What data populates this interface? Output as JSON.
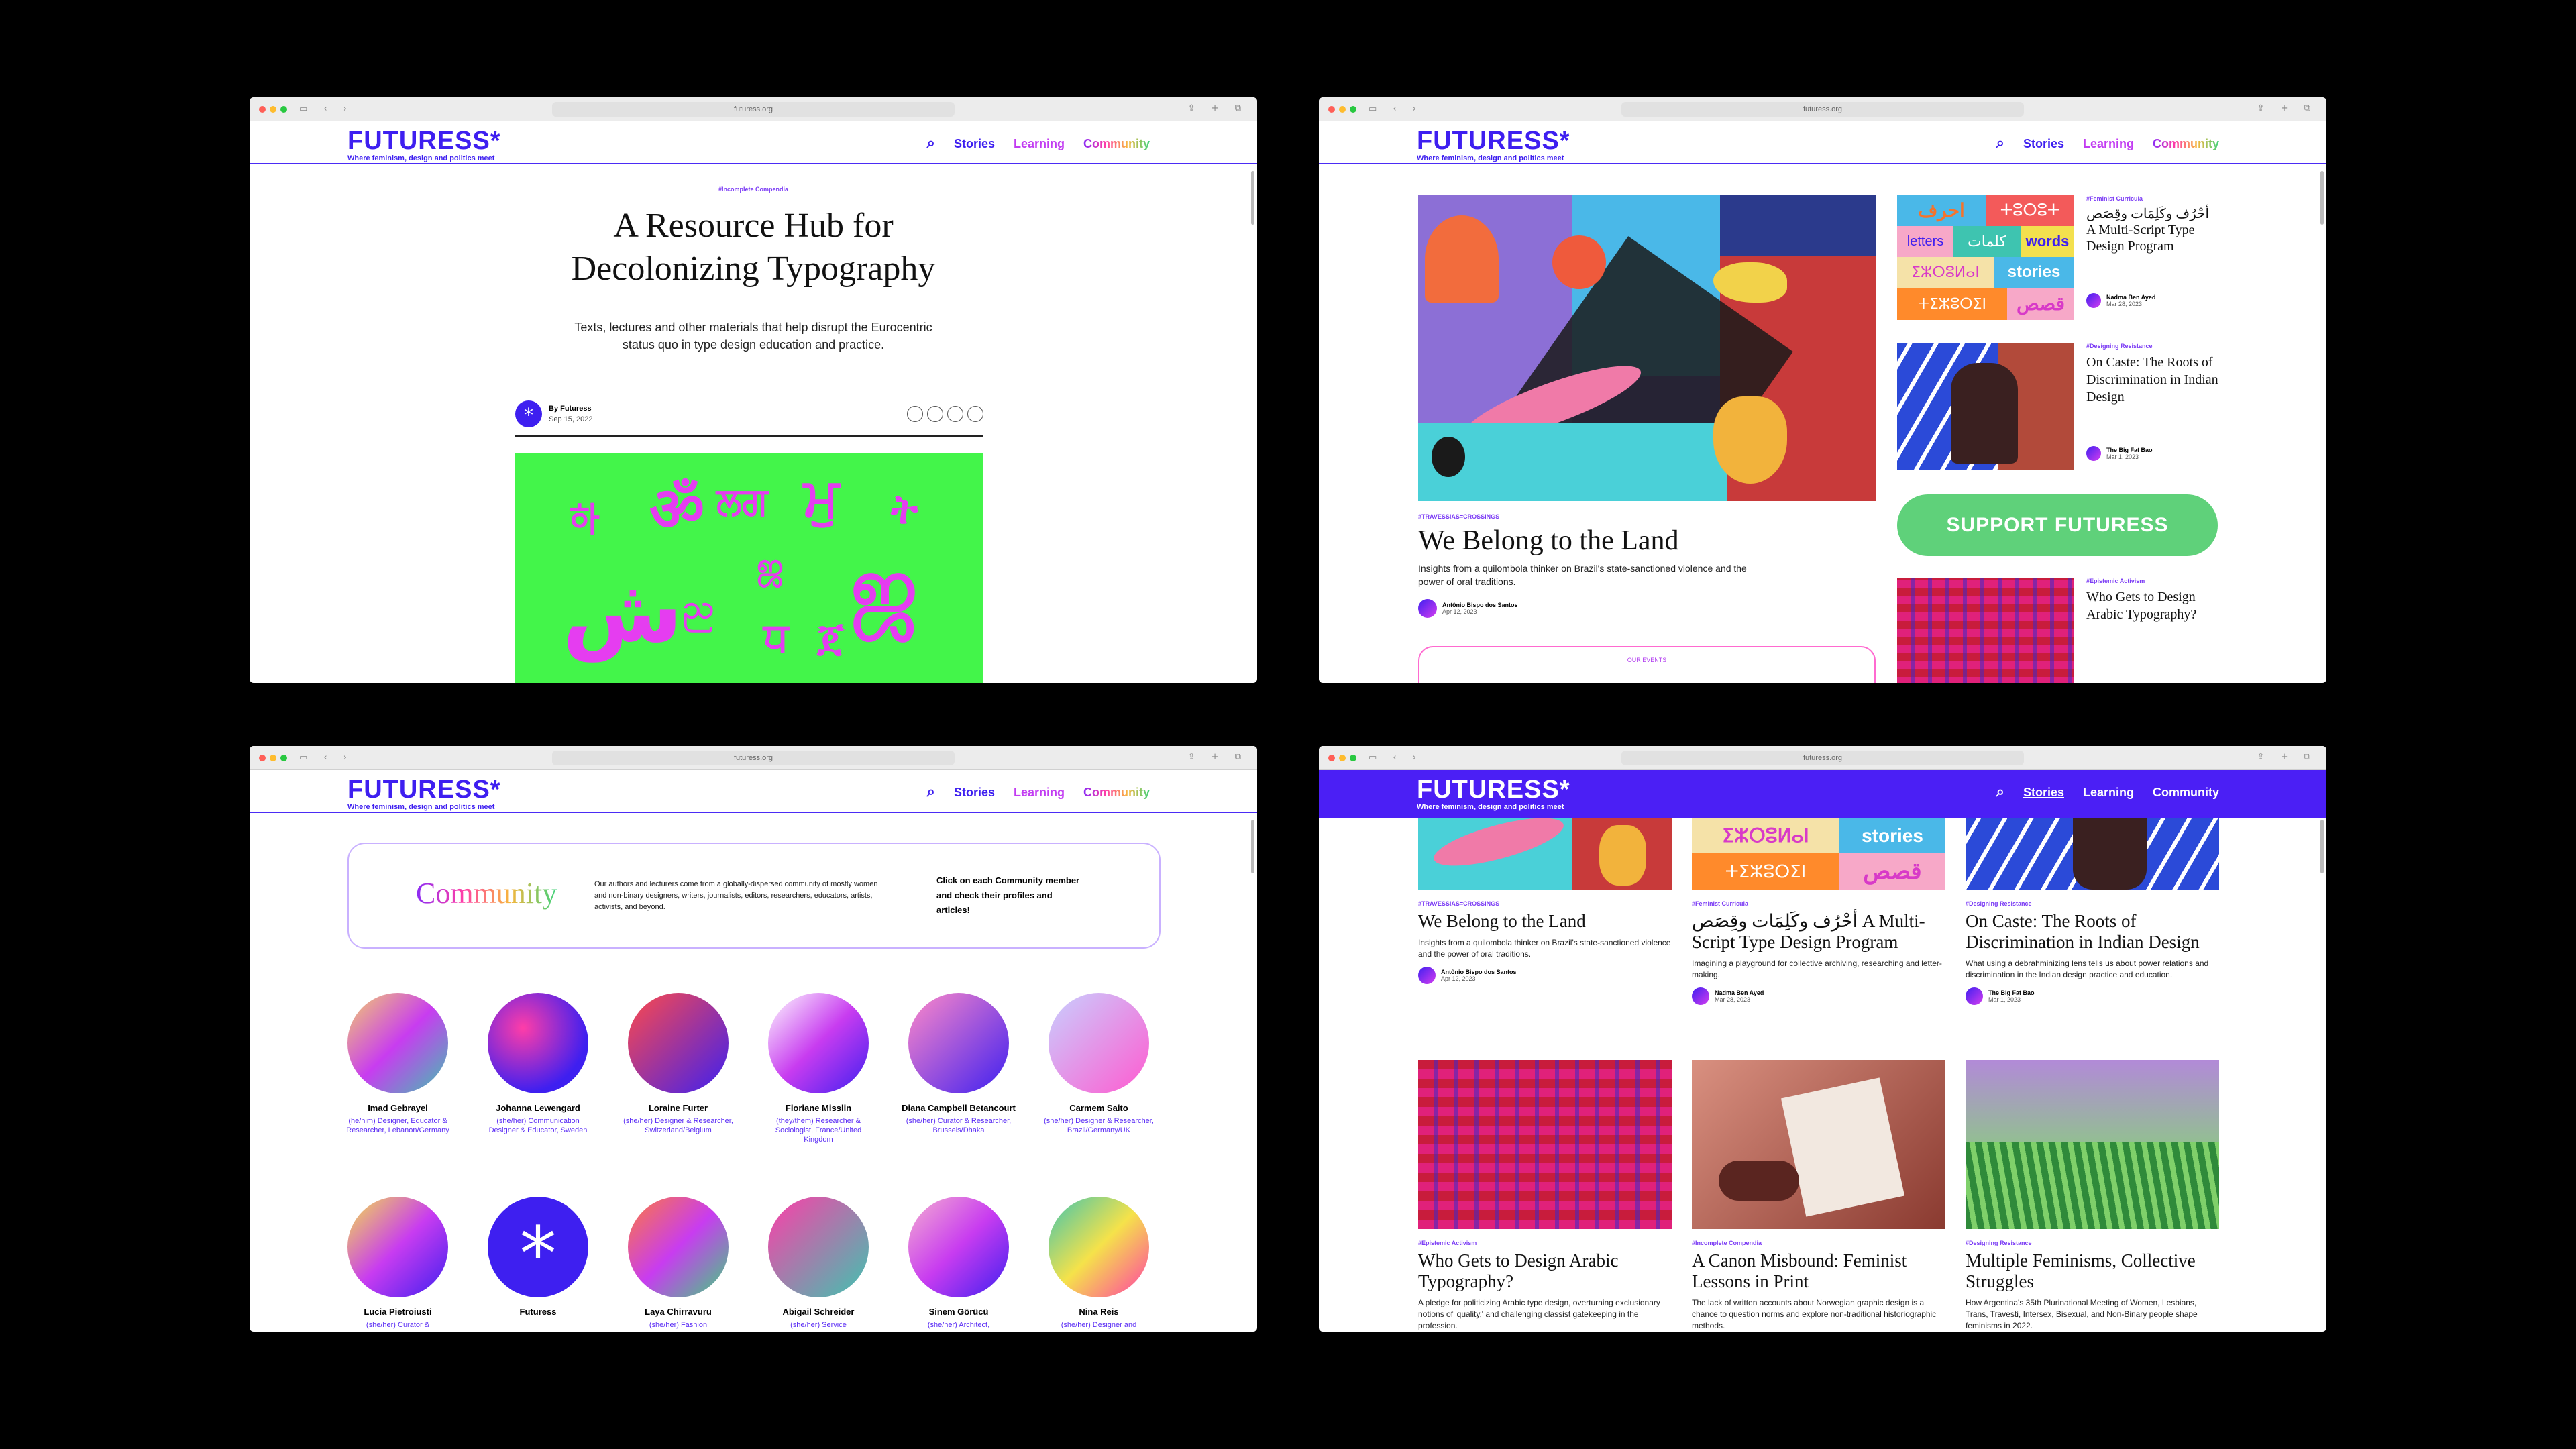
{
  "browser": {
    "url": "futuress.org"
  },
  "brand": {
    "logo": "FUTURESS*",
    "tagline": "Where feminism, design and politics meet",
    "primary": "#3e1ff0",
    "accent_pink": "#e53df0",
    "accent_green": "#5fd17a"
  },
  "nav": {
    "stories": "Stories",
    "learning": "Learning",
    "community": "Community"
  },
  "article": {
    "tag": "#Incomplete Compendia",
    "title_line1": "A Resource Hub for",
    "title_line2": "Decolonizing Typography",
    "sub_line1": "Texts, lectures and other materials that help disrupt the Eurocentric",
    "sub_line2": "status quo in type design education and practice.",
    "author": "By Futuress",
    "date": "Sep 15, 2022",
    "glyphs": [
      "하",
      "ॐ",
      "ਲਗ",
      "ਮੁ",
      "ት",
      "ش",
      "ஜ",
      "ஜ",
      "ည",
      "ਧ",
      "ጀ"
    ]
  },
  "home": {
    "feature": {
      "tag": "#TRAVESSIAS=CROSSINGS",
      "title": "We Belong to the Land",
      "excerpt_line1": "Insights from a quilombola thinker on Brazil's state-sanctioned violence and the",
      "excerpt_line2": "power of oral traditions.",
      "author": "Antônio Bispo dos Santos",
      "date": "Apr 12, 2023"
    },
    "side": [
      {
        "tag": "#Feminist Curricula",
        "title": "أحْرُف وكَلِمَات وقِصَص A Multi-Script Type Design Program",
        "author": "Nadma Ben Ayed",
        "date": "Mar 28, 2023"
      },
      {
        "tag": "#Designing Resistance",
        "title": "On Caste: The Roots of Discrimination in Indian Design",
        "author": "The Big Fat Bao",
        "date": "Mar 1, 2023"
      },
      {
        "tag": "#Epistemic Activism",
        "title": "Who Gets to Design Arabic Typography?"
      }
    ],
    "support": "SUPPORT FUTURESS",
    "events": "OUR EVENTS",
    "tile_words": [
      "احرف",
      "ⵜⵓⵔⵓⵜ",
      "letters",
      "كلمات",
      "words",
      "stories",
      "ⵉⵣⵔⵓⵍⴰⵏ",
      "قصص"
    ]
  },
  "community": {
    "title": "Community",
    "desc": "Our authors and lecturers come from a globally-dispersed community of mostly women and non-binary designers, writers, journalists, editors, researchers, educators, artists, activists, and beyond.",
    "cta": "Click on each Community member and check their profiles and articles!",
    "people": [
      {
        "name": "Imad Gebrayel",
        "role": "(he/him) Designer, Educator & Researcher, Lebanon/Germany"
      },
      {
        "name": "Johanna Lewengard",
        "role": "(she/her) Communication Designer & Educator, Sweden"
      },
      {
        "name": "Loraine Furter",
        "role": "(she/her) Designer & Researcher, Switzerland/Belgium"
      },
      {
        "name": "Floriane Misslin",
        "role": "(they/them) Researcher & Sociologist, France/United Kingdom"
      },
      {
        "name": "Diana Campbell Betancourt",
        "role": "(she/her) Curator & Researcher, Brussels/Dhaka"
      },
      {
        "name": "Carmem Saito",
        "role": "(she/her) Designer & Researcher, Brazil/Germany/UK"
      },
      {
        "name": "Lucia Pietroiusti",
        "role": "(she/her) Curator &"
      },
      {
        "name": "Futuress",
        "role": ""
      },
      {
        "name": "Laya Chirravuru",
        "role": "(she/her) Fashion"
      },
      {
        "name": "Abigail Schreider",
        "role": "(she/her) Service"
      },
      {
        "name": "Sinem Görücü",
        "role": "(she/her) Architect,"
      },
      {
        "name": "Nina Reis",
        "role": "(she/her) Designer and"
      }
    ]
  },
  "stories": {
    "cards": [
      {
        "tag": "#TRAVESSIAS=CROSSINGS",
        "title": "We Belong to the Land",
        "excerpt": "Insights from a quilombola thinker on Brazil's state-sanctioned violence and the power of oral traditions.",
        "author": "Antônio Bispo dos Santos",
        "date": "Apr 12, 2023"
      },
      {
        "tag": "#Feminist Curricula",
        "title": "أحْرُف وكَلِمَات وقِصَص A Multi-Script Type Design Program",
        "excerpt": "Imagining a playground for collective archiving, researching and letter-making.",
        "author": "Nadma Ben Ayed",
        "date": "Mar 28, 2023"
      },
      {
        "tag": "#Designing Resistance",
        "title": "On Caste: The Roots of Discrimination in Indian Design",
        "excerpt": "What using a debrahminizing lens tells us about power relations and discrimination in the Indian design practice and education.",
        "author": "The Big Fat Bao",
        "date": "Mar 1, 2023"
      },
      {
        "tag": "#Epistemic Activism",
        "title": "Who Gets to Design Arabic Typography?",
        "excerpt": "A pledge for politicizing Arabic type design, overturning exclusionary notions of 'quality,' and challenging classist gatekeeping in the profession."
      },
      {
        "tag": "#Incomplete Compendia",
        "title": "A Canon Misbound: Feminist Lessons in Print",
        "excerpt": "The lack of written accounts about Norwegian graphic design is a chance to question norms and explore non-traditional historiographic methods."
      },
      {
        "tag": "#Designing Resistance",
        "title": "Multiple Feminisms, Collective Struggles",
        "excerpt": "How Argentina's 35th Plurinational Meeting of Women, Lesbians, Trans, Travesti, Intersex, Bisexual, and Non-Binary people shape feminisms in 2022."
      }
    ]
  }
}
